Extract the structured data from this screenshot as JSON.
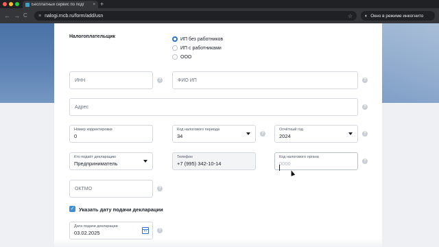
{
  "browser": {
    "tab_title": "Бесплатный сервис по подг",
    "tab_close": "×",
    "new_tab": "+",
    "url": "nalogi.rncb.ru/form/add/usn",
    "incognito_label": "Окно в режиме инкогнито",
    "back": "←",
    "forward": "→",
    "reload": "C",
    "bookmark": "☆",
    "incognito_icon": "◐",
    "tune_icon": "≡"
  },
  "form": {
    "taxpayer_label": "Налогоплательщик",
    "taxpayer_options": [
      {
        "label": "ИП без работников",
        "selected": true
      },
      {
        "label": "ИП с работниками",
        "selected": false
      },
      {
        "label": "ООО",
        "selected": false
      }
    ],
    "inn": {
      "placeholder": "ИНН"
    },
    "fio": {
      "placeholder": "ФИО ИП"
    },
    "address": {
      "placeholder": "Адрес"
    },
    "correction": {
      "label": "Номер корректировки",
      "value": "0"
    },
    "tax_period": {
      "label": "Код налогового периода",
      "value": "34"
    },
    "report_year": {
      "label": "Отчётный год",
      "value": "2024"
    },
    "submitter": {
      "label": "Кто подаёт декларацию",
      "value": "Предприниматель"
    },
    "phone": {
      "label": "Телефон",
      "value": "+7 (995) 342-10-14"
    },
    "tax_authority": {
      "label": "Код налогового органа",
      "placeholder": "0000"
    },
    "oktmo": {
      "placeholder": "ОКТМО"
    },
    "specify_date_label": "Указать дату подачи декларации",
    "specify_date_checked": true,
    "check_mark": "✓",
    "submit_date": {
      "label": "Дата подачи декларации",
      "value": "03.02.2025"
    },
    "help_icon": "?"
  },
  "colors": {
    "accent": "#2a6fd6",
    "checkbox": "#3d8fd6",
    "hero": "#5d82b4"
  }
}
